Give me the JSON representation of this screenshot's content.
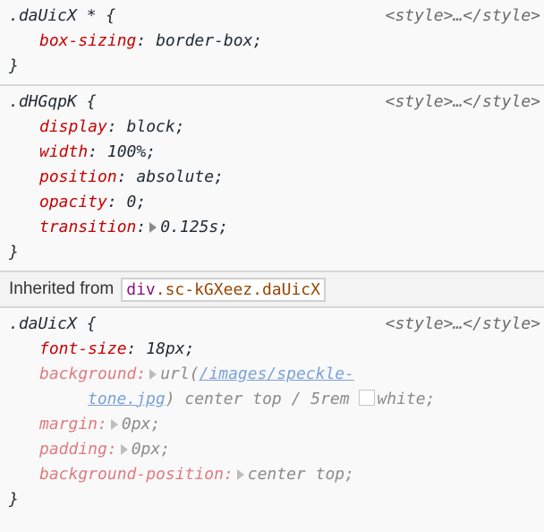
{
  "rules": [
    {
      "selector": ".daUicX * {",
      "source": "<style>…</style>",
      "declarations": [
        {
          "property": "box-sizing",
          "value": "border-box;"
        }
      ],
      "close": "}"
    },
    {
      "selector": ".dHGqpK {",
      "source": "<style>…</style>",
      "declarations": [
        {
          "property": "display",
          "value": "block;"
        },
        {
          "property": "width",
          "value": "100%;"
        },
        {
          "property": "position",
          "value": "absolute;"
        },
        {
          "property": "opacity",
          "value": "0;"
        },
        {
          "property": "transition",
          "value": "0.125s;",
          "expandable": true
        }
      ],
      "close": "}"
    }
  ],
  "inherited": {
    "label": "Inherited from",
    "node_tag": "div",
    "node_classes": ".sc-kGXeez.daUicX"
  },
  "inherited_rule": {
    "selector": ".daUicX {",
    "source": "<style>…</style>",
    "declarations": [
      {
        "property": "font-size",
        "value": "18px;"
      },
      {
        "property": "background",
        "value_prefix": "url(",
        "url_part1": "/images/speckle-",
        "url_part2": "tone.jpg",
        "value_suffix": ") center top / 5rem",
        "color_name": "white;",
        "color_hex": "#ffffff",
        "inactive": true
      },
      {
        "property": "margin",
        "value": "0px;",
        "inactive": true
      },
      {
        "property": "padding",
        "value": "0px;",
        "inactive": true
      },
      {
        "property": "background-position",
        "value": "center top;",
        "inactive": true
      }
    ],
    "close": "}"
  }
}
